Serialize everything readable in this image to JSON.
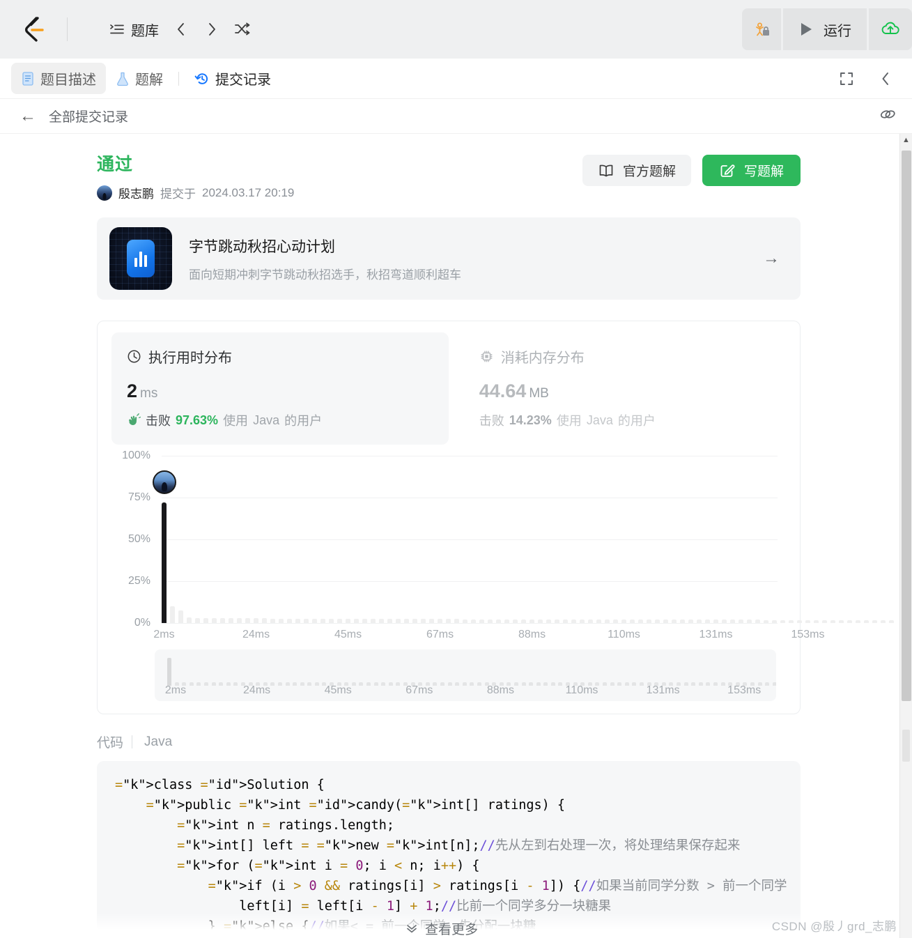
{
  "topnav": {
    "logo_icon": "leetcode-logo-icon",
    "problemset_label": "题库",
    "problemset_icon": "list-icon",
    "prev_icon": "chevron-left-icon",
    "next_icon": "chevron-right-icon",
    "shuffle_icon": "shuffle-icon",
    "debug_lock_icon": "debug-lock-icon",
    "run_icon": "play-icon",
    "run_label": "运行",
    "submit_icon": "cloud-upload-icon"
  },
  "tabs": [
    {
      "label": "题目描述",
      "icon": "document-icon",
      "active": true
    },
    {
      "label": "题解",
      "icon": "flask-icon",
      "active": false
    },
    {
      "label": "提交记录",
      "icon": "history-icon",
      "active": false
    }
  ],
  "tabbar_right": {
    "fullscreen_icon": "fullscreen-icon",
    "collapse_icon": "chevron-left-icon"
  },
  "subheader": {
    "back_icon": "arrow-left-icon",
    "title": "全部提交记录",
    "link_icon": "link-icon"
  },
  "submission": {
    "status": "通过",
    "status_color": "#2db55d",
    "user": "殷志鹏",
    "submitted_label": "提交于",
    "timestamp": "2024.03.17 20:19",
    "official_solution_label": "官方题解",
    "official_solution_icon": "book-icon",
    "write_solution_label": "写题解",
    "write_solution_icon": "pencil-square-icon"
  },
  "ad": {
    "title": "字节跳动秋招心动计划",
    "subtitle": "面向短期冲刺字节跳动秋招选手，秋招弯道顺利超车",
    "thumb_icon": "bar-chart-app-icon",
    "arrow_icon": "arrow-right-icon"
  },
  "stats": {
    "runtime": {
      "title": "执行用时分布",
      "icon": "clock-icon",
      "value": "2",
      "unit": "ms",
      "beat_icon": "clap-hands-icon",
      "beat_label": "击败",
      "percent": "97.63%",
      "suffix_pre": "使用",
      "language": "Java",
      "suffix_post": "的用户"
    },
    "memory": {
      "title": "消耗内存分布",
      "icon": "chip-icon",
      "value": "44.64",
      "unit": "MB",
      "beat_label": "击败",
      "percent": "14.23%",
      "suffix_pre": "使用",
      "language": "Java",
      "suffix_post": "的用户"
    }
  },
  "chart_data": {
    "type": "bar",
    "title": "执行用时分布",
    "xlabel": "",
    "ylabel": "",
    "ylim": [
      0,
      100
    ],
    "ytick_labels": [
      "100%",
      "75%",
      "50%",
      "25%",
      "0%"
    ],
    "ytick_values": [
      100,
      75,
      50,
      25,
      0
    ],
    "xtick_labels": [
      "2ms",
      "24ms",
      "45ms",
      "67ms",
      "88ms",
      "110ms",
      "131ms",
      "153ms"
    ],
    "xtick_positions": [
      0,
      11,
      22,
      33,
      44,
      55,
      66,
      77
    ],
    "grid": true,
    "legend": "none",
    "highlight_index": 0,
    "highlight_label": "2ms",
    "highlight_value": 72,
    "marker_icon": "user-avatar-marker",
    "values": [
      72,
      10,
      7.5,
      3.2,
      3.0,
      3.0,
      3.0,
      2.8,
      2.8,
      2.8,
      2.8,
      2.8,
      2.8,
      2.6,
      2.6,
      2.6,
      2.6,
      2.6,
      2.6,
      2.6,
      2.6,
      2.4,
      2.4,
      2.4,
      2.4,
      2.4,
      2.4,
      2.4,
      2.4,
      2.4,
      2.4,
      2.4,
      2.4,
      2.4,
      2.4,
      2.4,
      2.2,
      2.2,
      2.2,
      2.2,
      2.2,
      2.2,
      2.2,
      2.2,
      2.2,
      2.2,
      2.2,
      2.2,
      2.2,
      2.2,
      2.2,
      2.2,
      2.2,
      2.2,
      2.0,
      2.0,
      2.0,
      2.0,
      2.0,
      2.0,
      2.0,
      2.0,
      2.0,
      2.0,
      2.0,
      2.0,
      2.0,
      2.0,
      2.0,
      2.0,
      2.0,
      2.0,
      1.8,
      1.8,
      1.8,
      1.8,
      1.8,
      1.8,
      1.8,
      1.8,
      1.8,
      1.8,
      1.8,
      1.8,
      1.8,
      1.6,
      1.6,
      1.6
    ],
    "minimap": {
      "xtick_labels": [
        "2ms",
        "24ms",
        "45ms",
        "67ms",
        "88ms",
        "110ms",
        "131ms",
        "153ms"
      ],
      "highlight_index": 0
    }
  },
  "code_section": {
    "label": "代码",
    "language": "Java",
    "view_more_label": "查看更多",
    "view_more_icon": "chevron-double-down-icon",
    "lines": [
      "class Solution {",
      "    public int candy(int[] ratings) {",
      "        int n = ratings.length;",
      "        int[] left = new int[n];//先从左到右处理一次，将处理结果保存起来",
      "        for (int i = 0; i < n; i++) {",
      "            if (i > 0 && ratings[i] > ratings[i - 1]) {//如果当前同学分数 > 前一个同学",
      "                left[i] = left[i - 1] + 1;//比前一个同学多分一块糖果",
      "            } else {//如果< = 前一个同学，先分配一块糖"
    ]
  },
  "watermark": "CSDN @殷丿grd_志鹏"
}
